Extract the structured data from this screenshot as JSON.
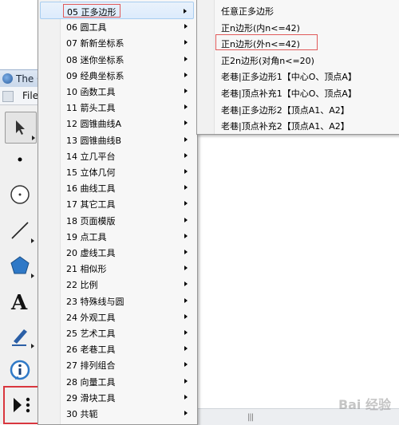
{
  "window": {
    "title": "The G",
    "menu_file": "File"
  },
  "left_menu": {
    "items": [
      {
        "label": "05 正多边形",
        "submenu": true
      },
      {
        "label": "06 圆工具",
        "submenu": true
      },
      {
        "label": "07 新新坐标系",
        "submenu": true
      },
      {
        "label": "08 迷你坐标系",
        "submenu": true
      },
      {
        "label": "09 经典坐标系",
        "submenu": true
      },
      {
        "label": "10 函数工具",
        "submenu": true
      },
      {
        "label": "11 箭头工具",
        "submenu": true
      },
      {
        "label": "12 圆锥曲线A",
        "submenu": true
      },
      {
        "label": "13 圆锥曲线B",
        "submenu": true
      },
      {
        "label": "14 立几平台",
        "submenu": true
      },
      {
        "label": "15 立体几何",
        "submenu": true
      },
      {
        "label": "16 曲线工具",
        "submenu": true
      },
      {
        "label": "17 其它工具",
        "submenu": true
      },
      {
        "label": "18 页面模版",
        "submenu": true
      },
      {
        "label": "19 点工具",
        "submenu": true
      },
      {
        "label": "20 虚线工具",
        "submenu": true
      },
      {
        "label": "21 相似形",
        "submenu": true
      },
      {
        "label": "22 比例",
        "submenu": true
      },
      {
        "label": "23 特殊线与圆",
        "submenu": true
      },
      {
        "label": "24 外观工具",
        "submenu": true
      },
      {
        "label": "25 艺术工具",
        "submenu": true
      },
      {
        "label": "26 老巷工具",
        "submenu": true
      },
      {
        "label": "27 排列组合",
        "submenu": true
      },
      {
        "label": "28 向量工具",
        "submenu": true
      },
      {
        "label": "29 滑块工具",
        "submenu": true
      },
      {
        "label": "30 共轭",
        "submenu": true
      }
    ]
  },
  "right_menu": {
    "items": [
      {
        "label": "任意正多边形"
      },
      {
        "label": "正n边形(内n<=42)"
      },
      {
        "label": "正n边形(外n<=42)"
      },
      {
        "label": "正2n边形(对角n<=20)"
      },
      {
        "label": "老巷|正多边形1【中心O、顶点A】"
      },
      {
        "label": "老巷|顶点补充1【中心O、顶点A】"
      },
      {
        "label": "老巷|正多边形2【顶点A1、A2】"
      },
      {
        "label": "老巷|顶点补充2【顶点A1、A2】"
      }
    ]
  },
  "tools": [
    {
      "icon": "arrow-select-icon"
    },
    {
      "icon": "point-icon"
    },
    {
      "icon": "compass-circle-icon"
    },
    {
      "icon": "line-segment-icon"
    },
    {
      "icon": "polygon-icon"
    },
    {
      "icon": "text-tool-icon"
    },
    {
      "icon": "marker-pen-icon"
    },
    {
      "icon": "information-icon"
    },
    {
      "icon": "custom-tool-icon"
    }
  ],
  "watermark": "Bai 经验",
  "colors": {
    "highlight_border": "#e05a5a",
    "hover_bg": "#dcebfc",
    "menu_bg": "#f7f7f7"
  }
}
